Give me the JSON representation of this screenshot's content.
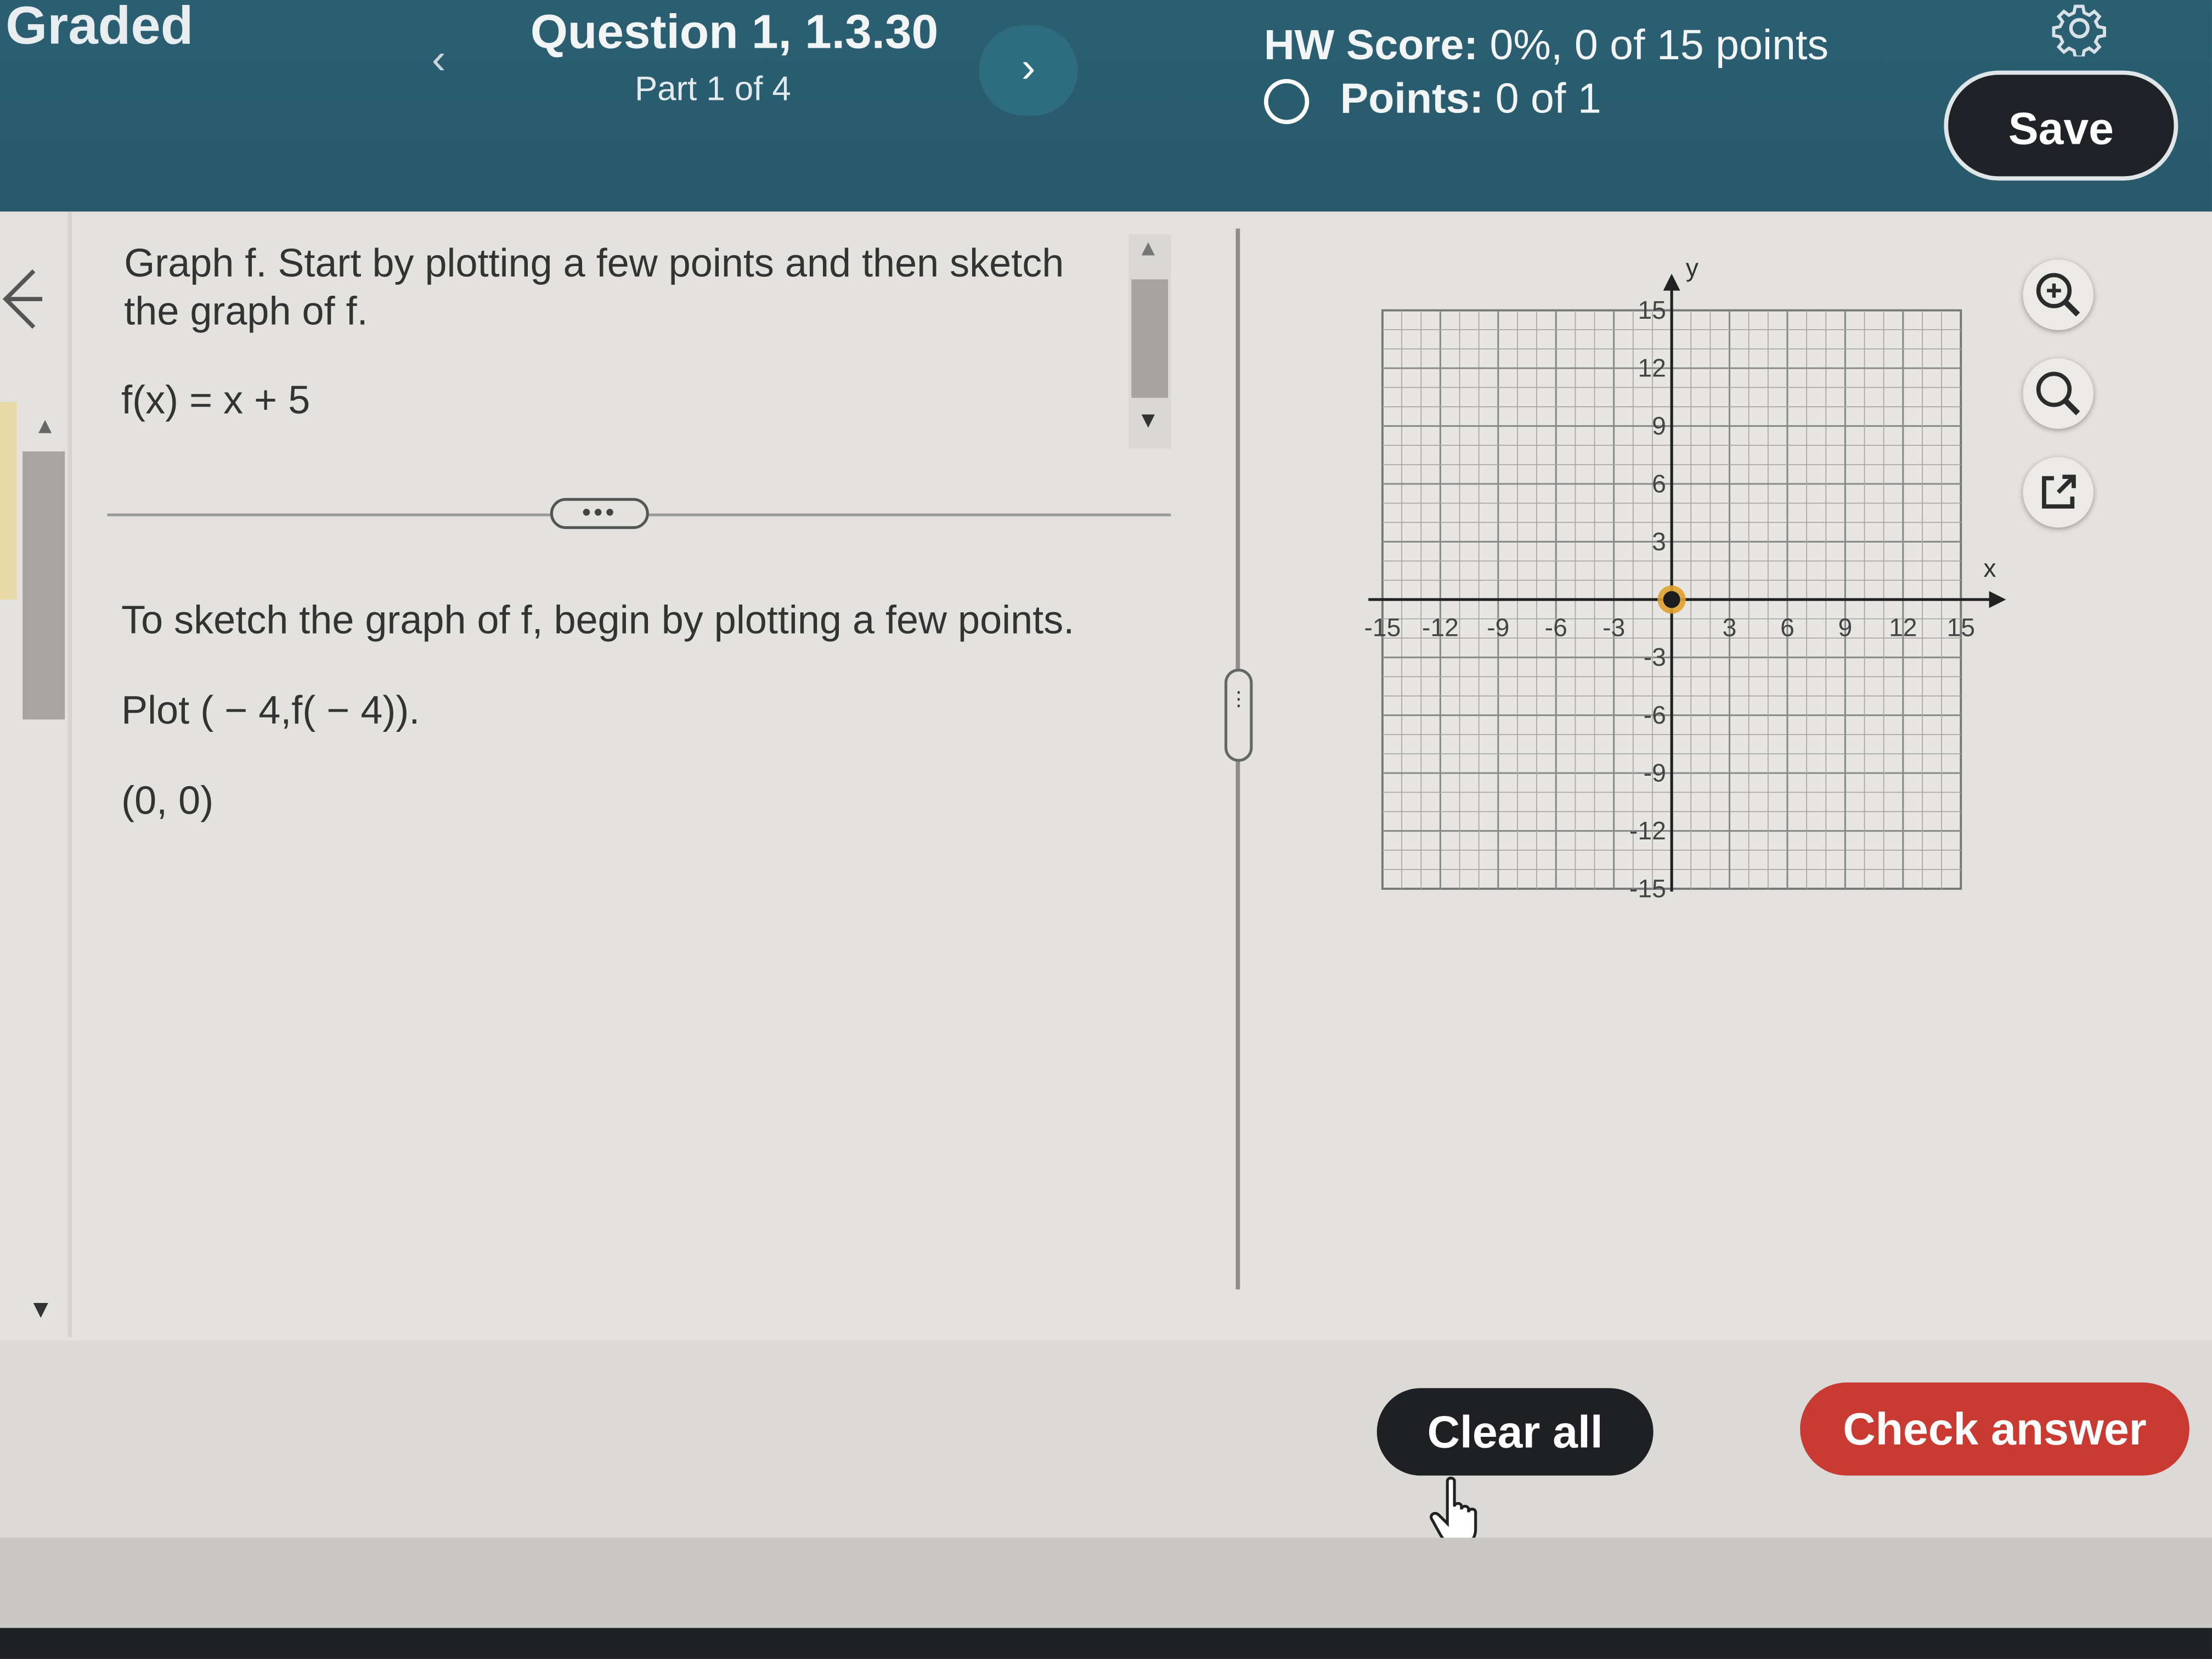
{
  "header": {
    "status": "Graded",
    "question_title": "Question 1, 1.3.30",
    "question_part": "Part 1 of 4",
    "hw_score_label": "HW Score:",
    "hw_score_value": "0%, 0 of 15 points",
    "points_label": "Points:",
    "points_value": "0 of 1",
    "save_label": "Save"
  },
  "question": {
    "prompt": "Graph f. Start by plotting a few points and then sketch the graph of f.",
    "function": "f(x) = x + 5",
    "instruction": "To sketch the graph of f, begin by plotting a few points.",
    "plot_prompt": "Plot ( − 4,f( − 4)).",
    "answer": "(0, 0)"
  },
  "graph": {
    "x_label": "x",
    "y_label": "y",
    "x_ticks": [
      -15,
      -12,
      -9,
      -6,
      -3,
      3,
      6,
      9,
      12,
      15
    ],
    "y_ticks": [
      15,
      12,
      9,
      6,
      3,
      -3,
      -6,
      -9,
      -12,
      -15
    ],
    "range": [
      -15,
      15
    ],
    "plotted_point": {
      "x": 0,
      "y": 0
    },
    "point_color": "#e0a030"
  },
  "icons": [
    "back-arrow-icon",
    "gear-icon",
    "zoom-in-icon",
    "zoom-out-icon",
    "popout-icon",
    "hand-cursor-icon"
  ],
  "footer": {
    "clear_label": "Clear all",
    "check_label": "Check answer"
  },
  "colors": {
    "header_bg": "#2c5f72",
    "check_btn": "#c83a32",
    "dark_btn": "#1e2023"
  }
}
